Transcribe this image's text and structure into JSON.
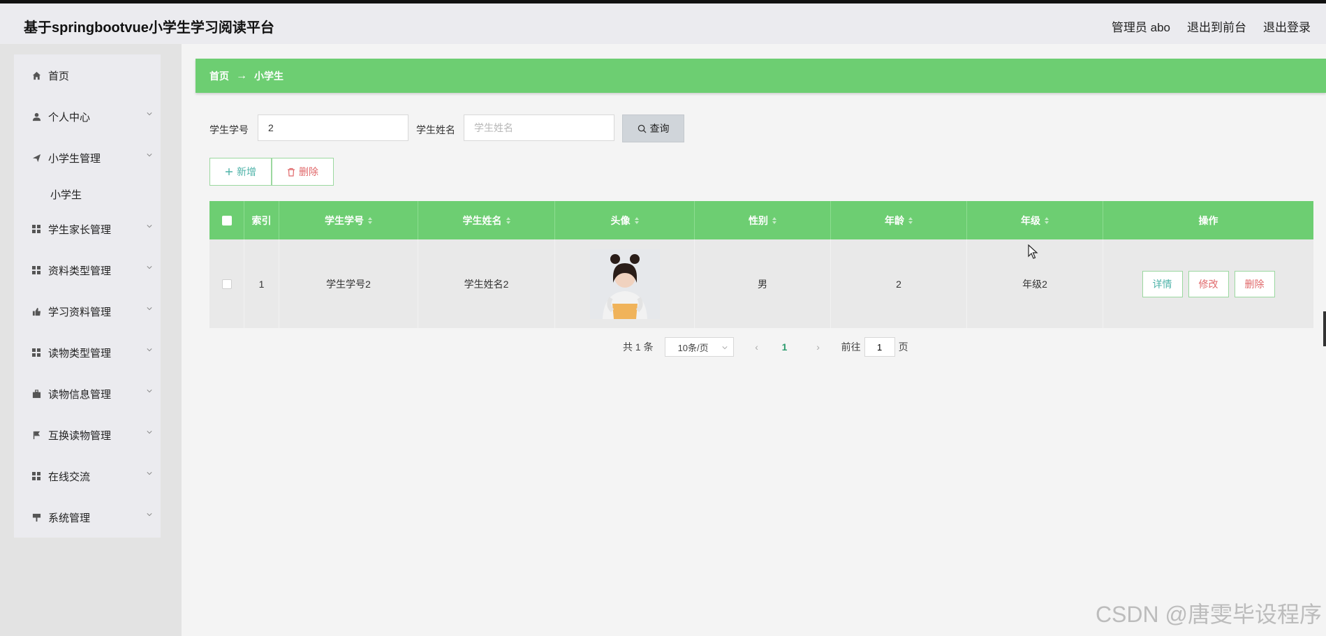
{
  "header": {
    "title": "基于springbootvue小学生学习阅读平台",
    "admin": "管理员 abo",
    "to_front": "退出到前台",
    "logout": "退出登录"
  },
  "sidebar": {
    "items": [
      {
        "label": "首页",
        "icon": "home-icon"
      },
      {
        "label": "个人中心",
        "icon": "user-icon"
      },
      {
        "label": "小学生管理",
        "icon": "paper-plane-icon"
      },
      {
        "label": "学生家长管理",
        "icon": "grid-icon"
      },
      {
        "label": "资料类型管理",
        "icon": "grid-icon"
      },
      {
        "label": "学习资料管理",
        "icon": "thumb-icon"
      },
      {
        "label": "读物类型管理",
        "icon": "grid-icon"
      },
      {
        "label": "读物信息管理",
        "icon": "briefcase-icon"
      },
      {
        "label": "互换读物管理",
        "icon": "flag-icon"
      },
      {
        "label": "在线交流",
        "icon": "grid-icon"
      },
      {
        "label": "系统管理",
        "icon": "sign-icon"
      }
    ],
    "sub_item": "小学生"
  },
  "breadcrumb": {
    "home": "首页",
    "arrow": "→",
    "current": "小学生"
  },
  "search": {
    "id_label": "学生学号",
    "id_value": "2",
    "name_label": "学生姓名",
    "name_placeholder": "学生姓名",
    "query_label": "查询"
  },
  "actions": {
    "add_label": "新增",
    "delete_label": "删除"
  },
  "table": {
    "columns": [
      "索引",
      "学生学号",
      "学生姓名",
      "头像",
      "性别",
      "年龄",
      "年级",
      "操作"
    ],
    "rows": [
      {
        "index": "1",
        "student_id": "学生学号2",
        "student_name": "学生姓名2",
        "gender": "男",
        "age": "2",
        "grade": "年级2",
        "detail_label": "详情",
        "edit_label": "修改",
        "delete_label": "删除"
      }
    ]
  },
  "pagination": {
    "total": "共 1 条",
    "page_size": "10条/页",
    "current_page": "1",
    "goto_prefix": "前往",
    "goto_value": "1",
    "goto_suffix": "页"
  },
  "watermark": "CSDN @唐雯毕设程序"
}
